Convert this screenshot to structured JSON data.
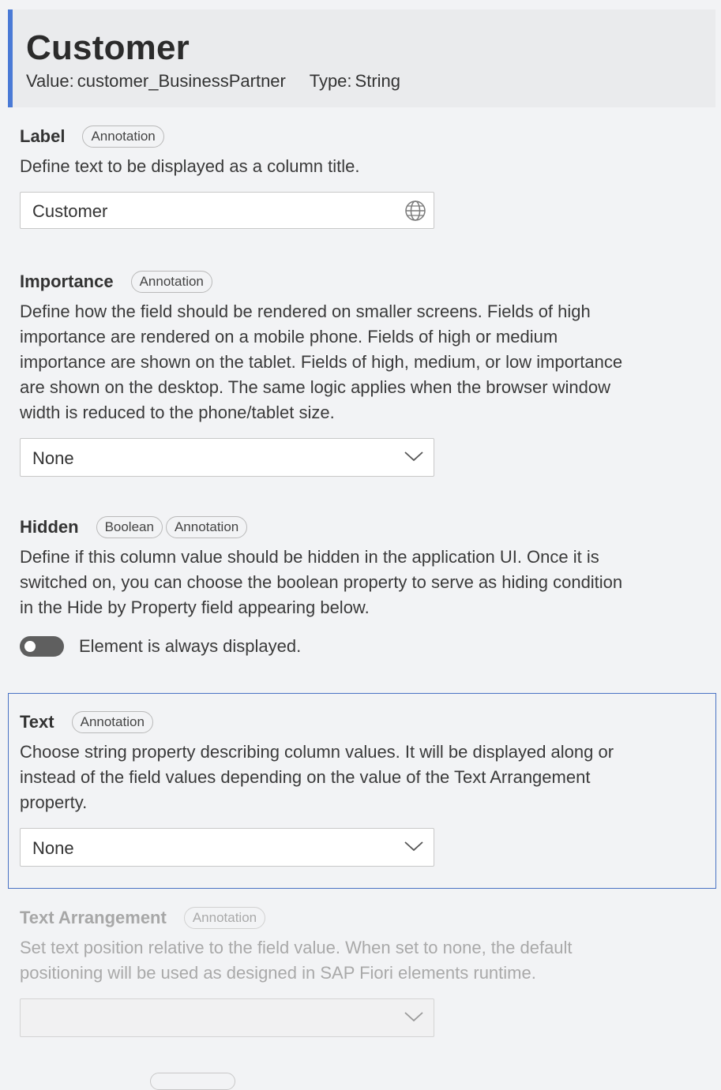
{
  "header": {
    "title": "Customer",
    "value_label": "Value:",
    "value": "customer_BusinessPartner",
    "type_label": "Type:",
    "type": "String",
    "accent_color": "#4a7ad6"
  },
  "label_section": {
    "title": "Label",
    "chips": [
      "Annotation"
    ],
    "description": "Define text to be displayed as a column title.",
    "input_value": "Customer",
    "icon": "globe-icon"
  },
  "importance_section": {
    "title": "Importance",
    "chips": [
      "Annotation"
    ],
    "description_lines": [
      "Define how the field should be rendered on smaller screens. Fields of high",
      "importance are rendered on a mobile phone. Fields of high or medium",
      "importance are shown on the tablet. Fields of high, medium, or low importance",
      "are shown on the desktop. The same logic applies when the browser window",
      "width is reduced to the phone/tablet size."
    ],
    "select_value": "None"
  },
  "hidden_section": {
    "title": "Hidden",
    "chips": [
      "Boolean",
      "Annotation"
    ],
    "description_lines": [
      "Define if this column value should be hidden in the application UI. Once it is",
      "switched on, you can choose the boolean property to serve as hiding condition",
      "in the Hide by Property field appearing below."
    ],
    "toggle_state": "off",
    "toggle_label": "Element is always displayed."
  },
  "text_section": {
    "title": "Text",
    "chips": [
      "Annotation"
    ],
    "description_lines": [
      "Choose string property describing column values. It will be displayed along or",
      "instead of the field values depending on the value of the Text Arrangement",
      "property."
    ],
    "select_value": "None",
    "focused": true,
    "focus_color": "#4a72c4"
  },
  "text_arrangement_section": {
    "title": "Text Arrangement",
    "chips": [
      "Annotation"
    ],
    "description_lines": [
      "Set text position relative to the field value. When set to none, the default",
      "positioning will be used as designed in SAP Fiori elements runtime."
    ],
    "select_value": "",
    "disabled": true
  }
}
